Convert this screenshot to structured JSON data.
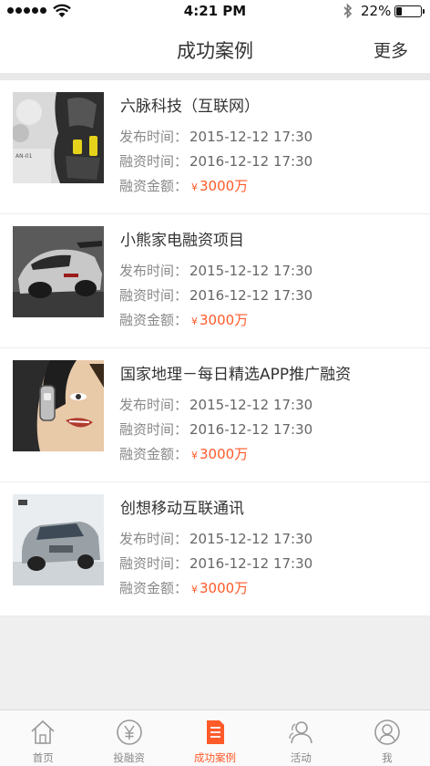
{
  "status_bar": {
    "time": "4:21 PM",
    "battery": "22%"
  },
  "nav": {
    "title": "成功案例",
    "more": "更多"
  },
  "labels": {
    "publish": "发布时间：",
    "finance": "融资时间：",
    "amount": "融资金额：",
    "yen": "¥"
  },
  "cases": [
    {
      "name": "六脉科技（互联网）",
      "publish_time": "2015-12-12  17:30",
      "finance_time": "2016-12-12  17:30",
      "amount": "3000万",
      "image": "robot-illustration"
    },
    {
      "name": "小熊家电融资项目",
      "publish_time": "2015-12-12  17:30",
      "finance_time": "2016-12-12  17:30",
      "amount": "3000万",
      "image": "sports-car-photo"
    },
    {
      "name": "国家地理－每日精选APP推广融资",
      "publish_time": "2015-12-12  17:30",
      "finance_time": "2016-12-12  17:30",
      "amount": "3000万",
      "image": "comic-face-illustration"
    },
    {
      "name": "创想移动互联通讯",
      "publish_time": "2015-12-12  17:30",
      "finance_time": "2016-12-12  17:30",
      "amount": "3000万",
      "image": "suv-car-photo"
    }
  ],
  "tabs": [
    {
      "label": "首页",
      "icon": "home-icon"
    },
    {
      "label": "投融资",
      "icon": "yen-circle-icon"
    },
    {
      "label": "成功案例",
      "icon": "document-list-icon",
      "active": true
    },
    {
      "label": "活动",
      "icon": "people-icon"
    },
    {
      "label": "我",
      "icon": "user-circle-icon"
    }
  ],
  "colors": {
    "accent": "#ff5a2a",
    "text": "#333333",
    "muted": "#888888"
  }
}
